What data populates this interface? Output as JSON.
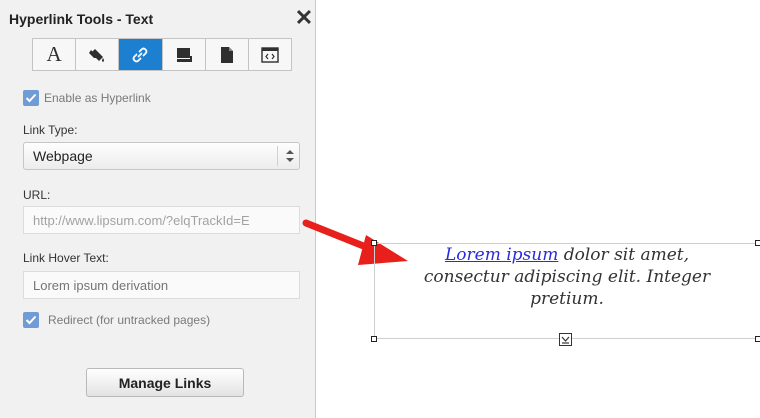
{
  "panel": {
    "title": "Hyperlink Tools - Text",
    "close_symbol": "✕",
    "tabs": [
      {
        "icon": "text-format-icon",
        "glyph": "A",
        "active": false
      },
      {
        "icon": "paint-bucket-icon",
        "active": false
      },
      {
        "icon": "link-icon",
        "active": true
      },
      {
        "icon": "stamp-icon",
        "active": false
      },
      {
        "icon": "page-icon",
        "active": false
      },
      {
        "icon": "html-code-icon",
        "active": false
      }
    ],
    "enable_hyperlink": {
      "label": "Enable as Hyperlink",
      "checked": true
    },
    "link_type": {
      "label": "Link Type:",
      "value": "Webpage"
    },
    "url": {
      "label": "URL:",
      "value": "http://www.lipsum.com/?elqTrackId=E"
    },
    "hover_text": {
      "label": "Link Hover Text:",
      "placeholder": "Lorem ipsum derivation"
    },
    "redirect": {
      "label": "Redirect (for untracked pages)",
      "checked": true
    },
    "manage_links_label": "Manage Links"
  },
  "canvas": {
    "link_text": "Lorem ipsum",
    "line1_rest": " dolor sit amet,",
    "line2": "consectur adipiscing elit. Integer",
    "line3": "pretium."
  },
  "colors": {
    "accent": "#1d7fcf",
    "checkbox": "#6f9bd6",
    "link": "#2a2adf",
    "arrow": "#e8201c"
  }
}
